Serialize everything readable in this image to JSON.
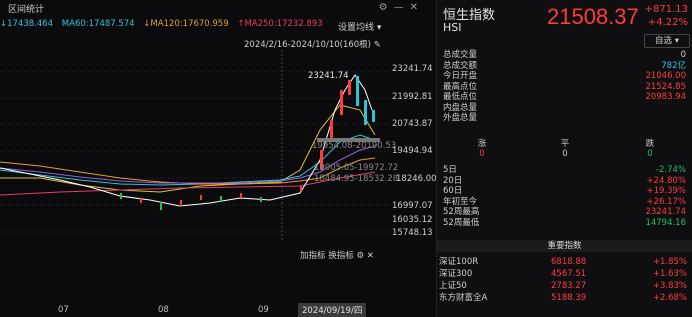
{
  "window": {
    "title": "区间统计"
  },
  "ma_legend": [
    {
      "text": "↓17438.464",
      "color": "#2ec4d6"
    },
    {
      "text": "MA60:17487.574",
      "color": "#2ec4d6"
    },
    {
      "text": "↓MA120:17670.959",
      "color": "#e0a030"
    },
    {
      "text": "↑MA250:17232.893",
      "color": "#e04060"
    }
  ],
  "chart_header": {
    "settings_label": "设置均线",
    "date_range": "2024/2/16-2024/10/10(160根)"
  },
  "axis": {
    "price_ticks": [
      "23241.74",
      "21992.81",
      "20743.87",
      "19494.94",
      "18246.00",
      "16997.07",
      "16035.12",
      "15748.13"
    ],
    "dates": [
      "07",
      "08",
      "09"
    ],
    "selected_date": "2024/09/19/四"
  },
  "chart_annotations": {
    "high_label": "23241.74",
    "cross_label_1": "19954.08-20190.53",
    "cross_label_2": "19005.05-19972.72",
    "cross_label_3": "18484.95-18532.28"
  },
  "indicators": {
    "add": "加指标",
    "switch": "换指标"
  },
  "quote": {
    "name": "恒生指数",
    "code": "HSI",
    "price": "21508.37",
    "change": "+871.13",
    "change_pct": "+4.22%",
    "watch_label": "自选"
  },
  "stats": [
    {
      "k": "总成交量",
      "v": "0",
      "c": "#cfcfcf"
    },
    {
      "k": "总成交额",
      "v": "782亿",
      "c": "#2ec4d6"
    },
    {
      "k": "今日开盘",
      "v": "21046.00",
      "c": "#ff3b3b"
    },
    {
      "k": "最高点位",
      "v": "21524.85",
      "c": "#ff3b3b"
    },
    {
      "k": "最低点位",
      "v": "20983.94",
      "c": "#ff3b3b"
    },
    {
      "k": "内盘总量",
      "v": "",
      "c": "#cfcfcf"
    },
    {
      "k": "外盘总量",
      "v": "",
      "c": "#cfcfcf"
    }
  ],
  "breadth": {
    "up_label": "涨",
    "flat_label": "平",
    "down_label": "跌",
    "up": "0",
    "flat": "0",
    "down": "0"
  },
  "periods": [
    {
      "k": "5日",
      "v": "-2.74%",
      "c": "#20c060"
    },
    {
      "k": "20日",
      "v": "+24.80%",
      "c": "#ff3b3b"
    },
    {
      "k": "60日",
      "v": "+19.39%",
      "c": "#ff3b3b"
    },
    {
      "k": "年初至今",
      "v": "+26.17%",
      "c": "#ff3b3b"
    },
    {
      "k": "52周最高",
      "v": "23241.74",
      "c": "#ff3b3b"
    },
    {
      "k": "52周最低",
      "v": "14794.16",
      "c": "#20c060"
    }
  ],
  "key_index": {
    "header": "重要指数",
    "items": [
      {
        "name": "深证100R",
        "price": "6818.88",
        "pct": "+1.85%"
      },
      {
        "name": "深证300",
        "price": "4567.51",
        "pct": "+1.63%"
      },
      {
        "name": "上证50",
        "price": "2783.27",
        "pct": "+3.83%"
      },
      {
        "name": "东方财富全A",
        "price": "5188.39",
        "pct": "+2.68%"
      }
    ]
  }
}
